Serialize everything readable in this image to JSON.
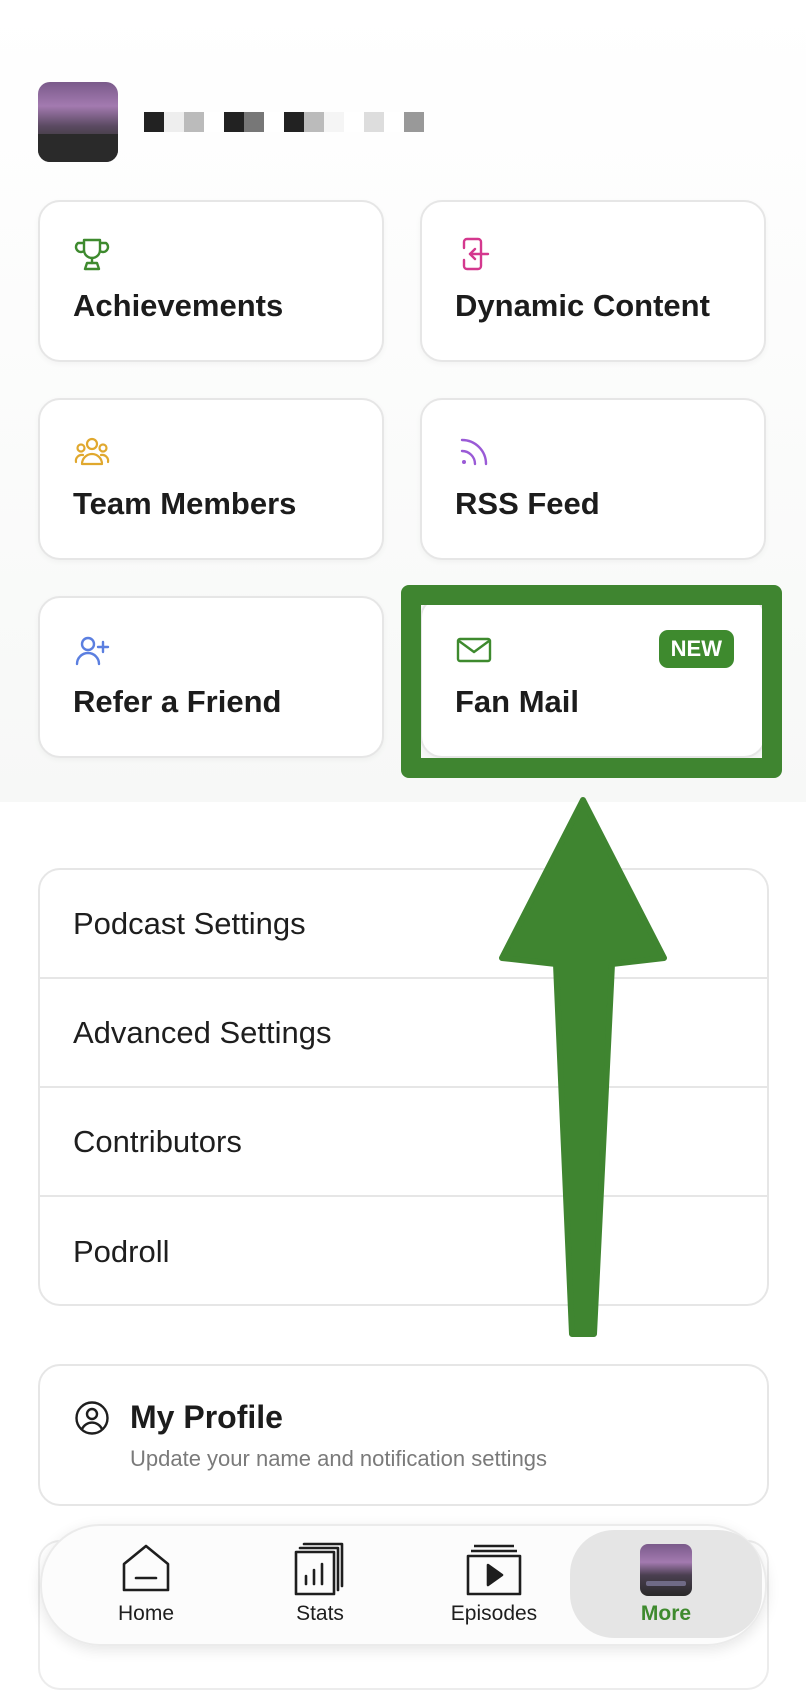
{
  "podcast": {
    "name_pixels": [
      "#222222",
      "#eeeeee",
      "#bbbbbb",
      "#ffffff",
      "#222222",
      "#777777",
      "#ffffff",
      "#222222",
      "#bbbbbb",
      "#f5f5f5",
      "#ffffff",
      "#dddddd",
      "#ffffff",
      "#999999"
    ]
  },
  "cards": [
    {
      "label": "Achievements",
      "icon": "trophy-icon",
      "color": "#3e8a2e"
    },
    {
      "label": "Dynamic Content",
      "icon": "insert-content-icon",
      "color": "#d4388e"
    },
    {
      "label": "Team Members",
      "icon": "team-icon",
      "color": "#e0a82e"
    },
    {
      "label": "RSS Feed",
      "icon": "rss-icon",
      "color": "#9a5ad6"
    },
    {
      "label": "Refer a Friend",
      "icon": "add-user-icon",
      "color": "#5b7fe0"
    },
    {
      "label": "Fan Mail",
      "icon": "mail-icon",
      "color": "#3e8a2e",
      "badge": "NEW"
    }
  ],
  "settings": [
    {
      "label": "Podcast Settings"
    },
    {
      "label": "Advanced Settings"
    },
    {
      "label": "Contributors"
    },
    {
      "label": "Podroll"
    }
  ],
  "profile": {
    "title": "My Profile",
    "subtitle": "Update your name and notification settings",
    "icon": "user-circle-icon"
  },
  "nav": [
    {
      "label": "Home",
      "icon": "home-icon"
    },
    {
      "label": "Stats",
      "icon": "stats-icon"
    },
    {
      "label": "Episodes",
      "icon": "episodes-icon"
    },
    {
      "label": "More",
      "icon": "podcast-thumbnail",
      "active": true
    }
  ],
  "colors": {
    "accent": "#3e8a2e",
    "annotation": "#3f8530"
  }
}
